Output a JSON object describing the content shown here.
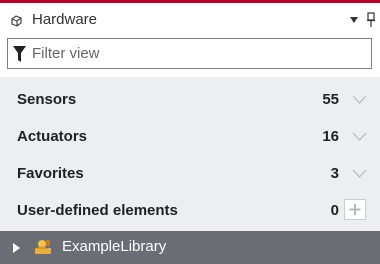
{
  "panel": {
    "title": "Hardware",
    "icons": [
      "hardware-icon",
      "dropdown-arrow-icon",
      "pin-icon"
    ],
    "accent_color": "#c0002b"
  },
  "filter": {
    "placeholder": "Filter view",
    "icon": "funnel-icon"
  },
  "items": [
    {
      "label": "Sensors",
      "count": "55",
      "action": "chevron-down-icon"
    },
    {
      "label": "Actuators",
      "count": "16",
      "action": "chevron-down-icon"
    },
    {
      "label": "Favorites",
      "count": "3",
      "action": "chevron-down-icon"
    },
    {
      "label": "User-defined elements",
      "count": "0",
      "action": "plus-icon"
    }
  ],
  "library": {
    "label": "ExampleLibrary",
    "icon": "library-user-icon",
    "background": "#6a6e74"
  }
}
